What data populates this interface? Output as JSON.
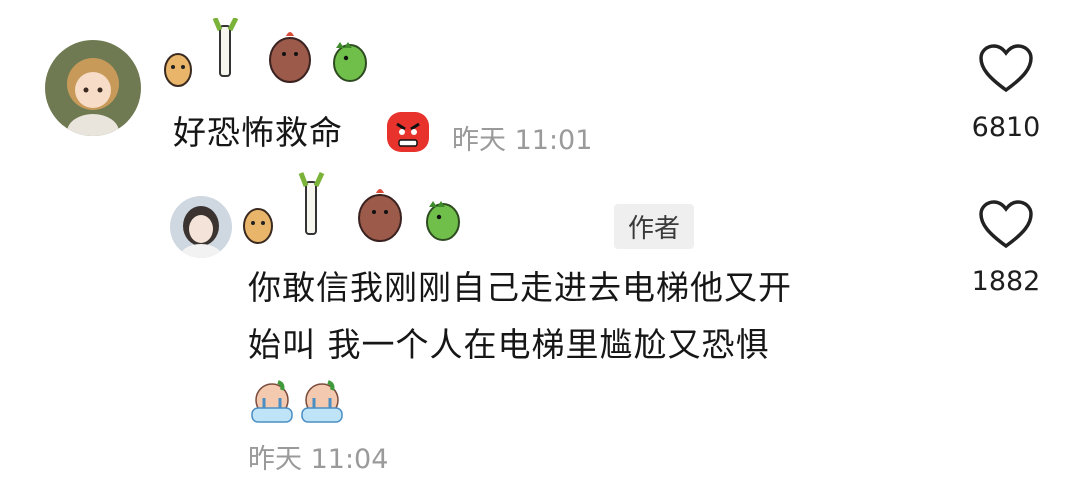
{
  "comments": [
    {
      "text": "好恐怖救命",
      "emoji": "angry-face",
      "time": "昨天 11:01",
      "likes": "6810"
    }
  ],
  "reply": {
    "badge": "作者",
    "text_line1": "你敢信我刚刚自己走进去电梯他又开",
    "text_line2": "始叫 我一个人在电梯里尴尬又恐惧",
    "emojis": [
      "crying-emoji",
      "crying-emoji"
    ],
    "time": "昨天 11:04",
    "likes": "1882"
  },
  "colors": {
    "timestamp": "#9a9a9a",
    "badge_bg": "#efefef",
    "angry_red": "#e8322c"
  }
}
